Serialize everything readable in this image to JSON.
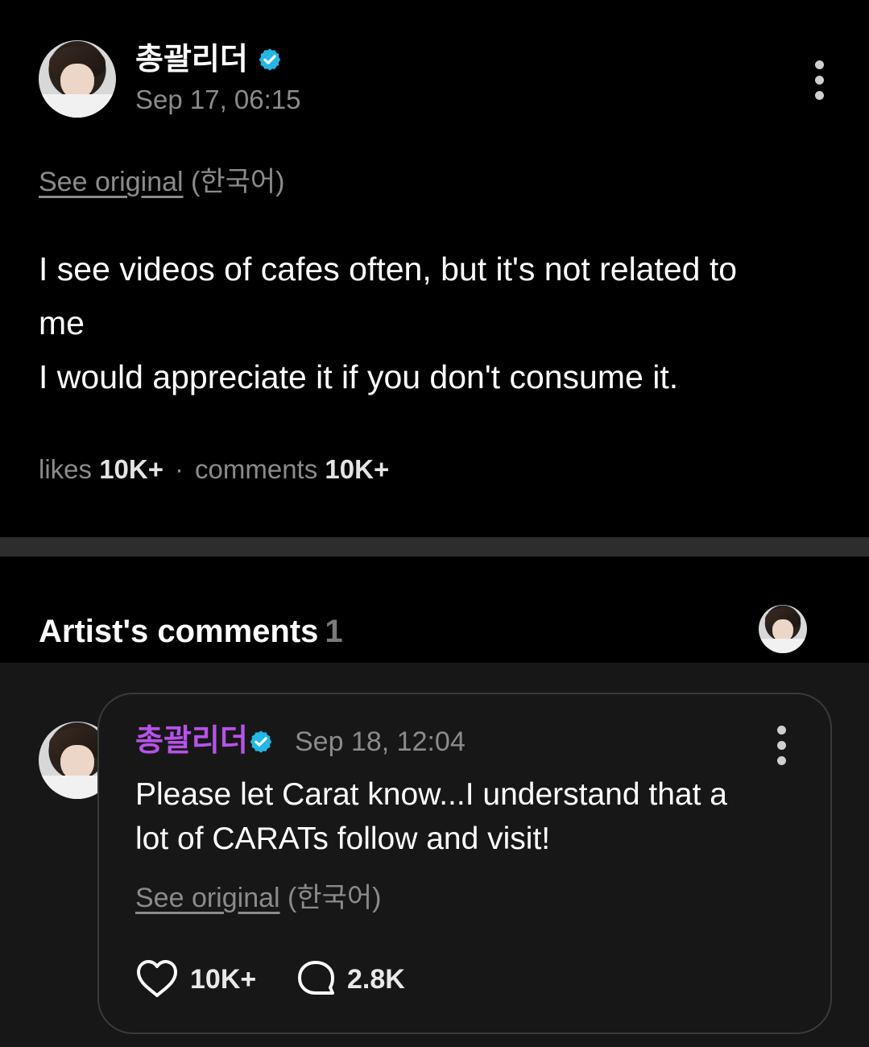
{
  "post": {
    "author": "총괄리더",
    "date": "Sep 17, 06:15",
    "see_original": "See original",
    "original_language": "(한국어)",
    "text_line1": "I see videos of cafes often, but it's not related to",
    "text_line2": "me",
    "text_line3": "I would appreciate it if you don't consume it.",
    "likes_label": "likes",
    "likes_count": "10K+",
    "separator": "·",
    "comments_label": "comments",
    "comments_count": "10K+"
  },
  "artist_comments": {
    "title": "Artist's comments",
    "count": "1"
  },
  "comment": {
    "author": "총괄리더",
    "date": "Sep 18, 12:04",
    "text_line1": "Please let Carat know...I understand that a",
    "text_line2": "lot of CARATs follow and visit!",
    "see_original": "See original",
    "original_language": "(한국어)",
    "likes_count": "10K+",
    "replies_count": "2.8K"
  },
  "colors": {
    "background": "#000000",
    "comment_background": "#171717",
    "verified_badge": "#23b7e5",
    "comment_author": "#b653e8",
    "muted_text": "#8b8b8b"
  },
  "icons": {
    "verified": "verified-badge-icon",
    "more": "more-vertical-icon",
    "like": "heart-icon",
    "reply": "comment-bubble-icon"
  }
}
